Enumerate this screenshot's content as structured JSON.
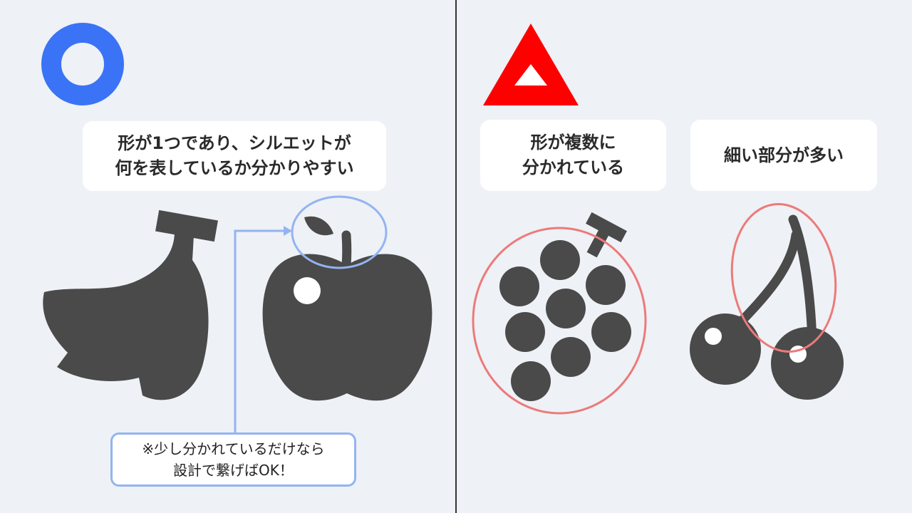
{
  "good_panel": {
    "mark": "○",
    "caption": "形が1つであり、シルエットが\n何を表しているか分かりやすい",
    "note": "※少し分かれているだけなら\n設計で繋げばOK！",
    "icons": [
      "banana-icon",
      "apple-icon"
    ]
  },
  "bad_panel": {
    "mark": "△",
    "caption_1": "形が複数に\n分かれている",
    "caption_2": "細い部分が多い",
    "icons": [
      "grape-icon",
      "cherry-icon"
    ]
  },
  "colors": {
    "background": "#eef1f5",
    "good_mark": "#3a73f5",
    "bad_mark": "#ff0000",
    "silhouette": "#4a4a4a",
    "highlight_circle_blue": "#93b4f2",
    "highlight_circle_red": "#ec7a7a"
  }
}
